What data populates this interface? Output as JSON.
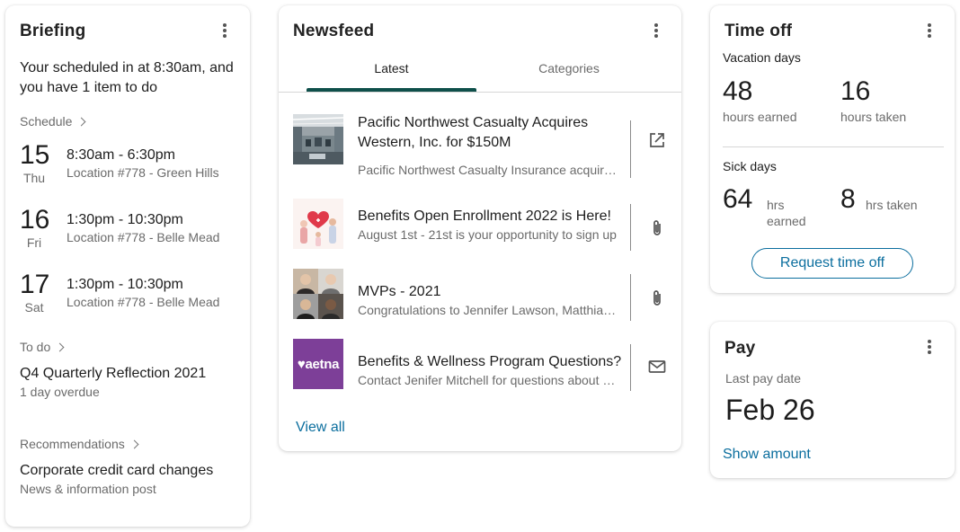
{
  "briefing": {
    "title": "Briefing",
    "summary": "Your scheduled in at 8:30am, and you have 1 item to do",
    "schedule_label": "Schedule",
    "schedule": [
      {
        "day": "15",
        "dow": "Thu",
        "time": "8:30am - 6:30pm",
        "location": "Location #778 - Green Hills"
      },
      {
        "day": "16",
        "dow": "Fri",
        "time": "1:30pm - 10:30pm",
        "location": "Location #778 - Belle Mead"
      },
      {
        "day": "17",
        "dow": "Sat",
        "time": "1:30pm - 10:30pm",
        "location": "Location #778 - Belle Mead"
      }
    ],
    "todo_label": "To do",
    "todo": {
      "title": "Q4 Quarterly Reflection 2021",
      "status": "1 day overdue"
    },
    "recommendations_label": "Recommendations",
    "recommendation": {
      "title": "Corporate credit card changes",
      "type": "News & information post"
    }
  },
  "newsfeed": {
    "title": "Newsfeed",
    "tabs": [
      {
        "label": "Latest",
        "active": true
      },
      {
        "label": "Categories",
        "active": false
      }
    ],
    "items": [
      {
        "title": "Pacific Northwest Casualty Acquires Western, Inc. for $150M",
        "subtitle": "Pacific Northwest Casualty Insurance acquired Western, Inc.",
        "action_icon": "external-link-icon"
      },
      {
        "title": "Benefits Open Enrollment 2022 is Here!",
        "subtitle": "August 1st - 21st is your opportunity to sign up",
        "action_icon": "paperclip-icon"
      },
      {
        "title": "MVPs - 2021",
        "subtitle": "Congratulations to Jennifer Lawson, Matthias and team",
        "action_icon": "paperclip-icon"
      },
      {
        "title": "Benefits & Wellness Program Questions?",
        "subtitle": "Contact Jenifer Mitchell for questions about benefits",
        "action_icon": "mail-icon",
        "thumb_text": "aetna"
      }
    ],
    "view_all": "View all"
  },
  "timeoff": {
    "title": "Time off",
    "vacation_label": "Vacation days",
    "vacation_earned": "48",
    "vacation_earned_label": "hours earned",
    "vacation_taken": "16",
    "vacation_taken_label": "hours taken",
    "sick_label": "Sick days",
    "sick_earned": "64",
    "sick_earned_unit": "hrs",
    "sick_earned_label": "earned",
    "sick_taken": "8",
    "sick_taken_label": "hrs taken",
    "request_button": "Request time off"
  },
  "pay": {
    "title": "Pay",
    "last_pay_label": "Last pay date",
    "last_pay_date": "Feb 26",
    "show_amount": "Show amount"
  },
  "colors": {
    "accent": "#0b6e9e",
    "tab_indicator": "#0e4f4a",
    "aetna": "#7d3f98"
  }
}
